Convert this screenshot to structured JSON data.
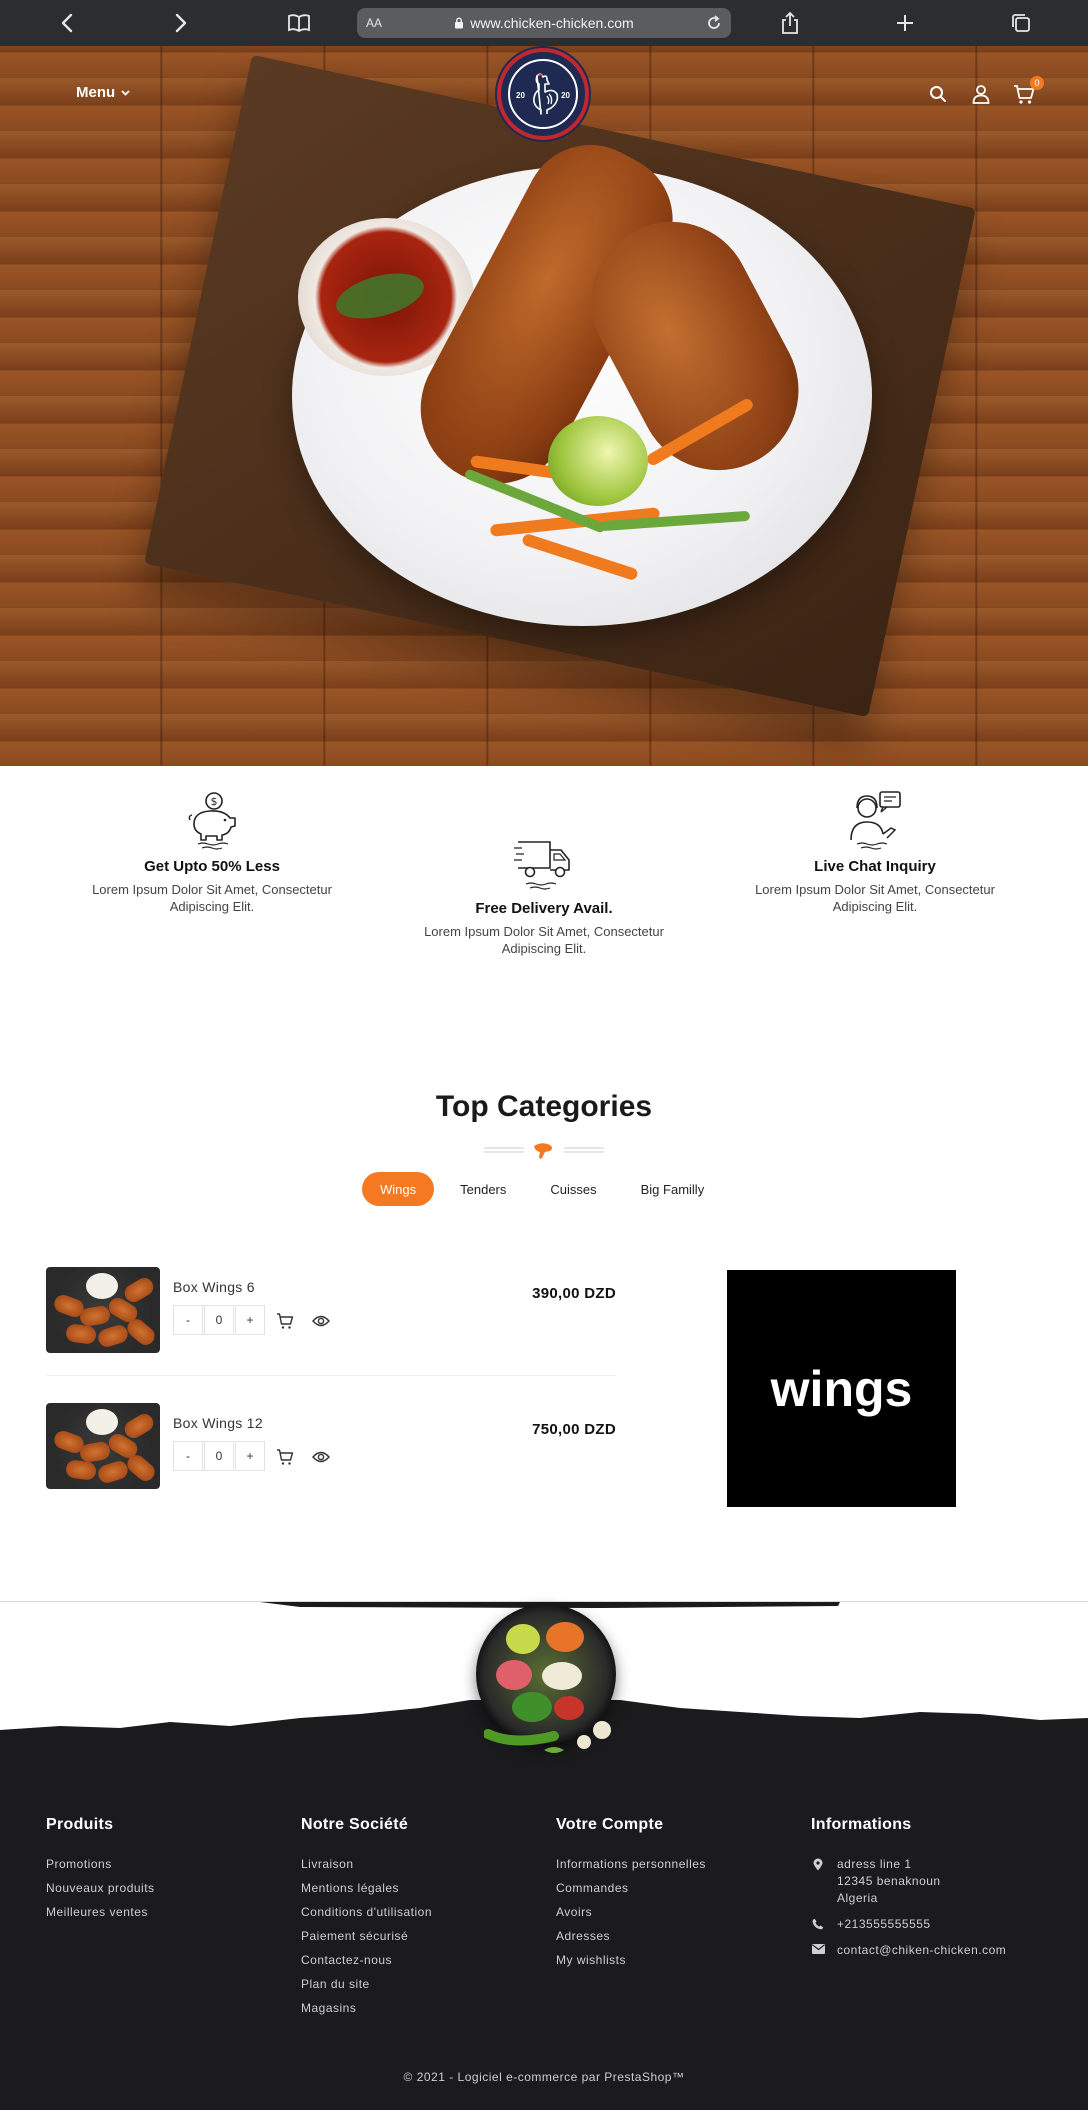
{
  "browser": {
    "text_size_label": "AA",
    "url": "www.chicken-chicken.com"
  },
  "header": {
    "menu_label": "Menu",
    "logo_year_left": "20",
    "logo_year_right": "20",
    "cart_count": "0",
    "accent_color": "#f47920"
  },
  "features": [
    {
      "title": "Get Upto 50% Less",
      "desc": "Lorem Ipsum Dolor Sit Amet, Consectetur Adipiscing Elit.",
      "icon": "piggy-bank-icon"
    },
    {
      "title": "Free Delivery Avail.",
      "desc": "Lorem Ipsum Dolor Sit Amet, Consectetur Adipiscing Elit.",
      "icon": "delivery-truck-icon"
    },
    {
      "title": "Live Chat Inquiry",
      "desc": "Lorem Ipsum Dolor Sit Amet, Consectetur Adipiscing Elit.",
      "icon": "support-agent-icon"
    }
  ],
  "categories": {
    "title": "Top Categories",
    "tabs": [
      {
        "label": "Wings",
        "active": true
      },
      {
        "label": "Tenders",
        "active": false
      },
      {
        "label": "Cuisses",
        "active": false
      },
      {
        "label": "Big Familly",
        "active": false
      }
    ],
    "products": [
      {
        "name": "Box Wings 6",
        "price": "390,00 DZD",
        "minus": "-",
        "qty": "0",
        "plus": "+"
      },
      {
        "name": "Box Wings 12",
        "price": "750,00 DZD",
        "minus": "-",
        "qty": "0",
        "plus": "+"
      }
    ],
    "banner_text": "wings"
  },
  "footer": {
    "produits": {
      "title": "Produits",
      "links": [
        "Promotions",
        "Nouveaux produits",
        "Meilleures ventes"
      ]
    },
    "societe": {
      "title": "Notre Société",
      "links": [
        "Livraison",
        "Mentions légales",
        "Conditions d'utilisation",
        "Paiement sécurisé",
        "Contactez-nous",
        "Plan du site",
        "Magasins"
      ]
    },
    "compte": {
      "title": "Votre Compte",
      "links": [
        "Informations personnelles",
        "Commandes",
        "Avoirs",
        "Adresses",
        "My wishlists"
      ]
    },
    "informations": {
      "title": "Informations",
      "address_line1": "adress line 1",
      "address_line2": "12345 benaknoun",
      "address_line3": "Algeria",
      "phone": "+213555555555",
      "email": "contact@chiken-chicken.com"
    },
    "copyright": "© 2021 - Logiciel e-commerce par PrestaShop™"
  }
}
